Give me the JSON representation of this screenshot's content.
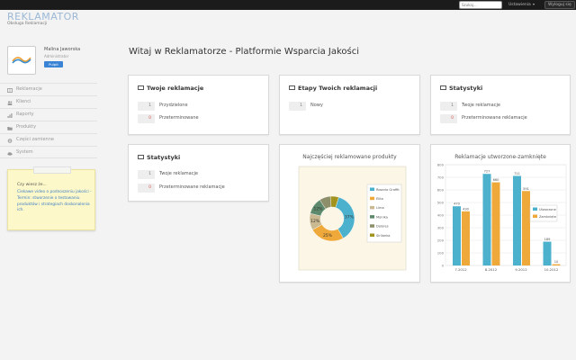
{
  "topbar": {
    "search_placeholder": "Szukaj...",
    "settings_label": "Ustawienia",
    "logout_label": "Wyloguj się"
  },
  "logo": {
    "title": "REKLAMATOR",
    "subtitle": "Obsługa Reklamacji"
  },
  "user": {
    "name": "Malina Jaworska",
    "role": "Administrator",
    "badge": "Pulpit"
  },
  "sidebar": {
    "items": [
      {
        "label": "Reklamacje",
        "icon": "book-icon"
      },
      {
        "label": "Klienci",
        "icon": "users-icon"
      },
      {
        "label": "Raporty",
        "icon": "bar-chart-icon"
      },
      {
        "label": "Produkty",
        "icon": "folder-icon"
      },
      {
        "label": "Części zamienne",
        "icon": "gear-icon"
      },
      {
        "label": "System",
        "icon": "cloud-icon"
      }
    ]
  },
  "note": {
    "title": "Czy wiesz że...",
    "link": "Ciekawe video o podnoszeniu jakości - Termin: stworzenie o testowaniu produktów i strategiach doskonalenia ich."
  },
  "page_title": "Witaj w Reklamatorze - Platformie Wsparcia Jakości",
  "panels": {
    "twoje": {
      "title": "Twoje reklamacje",
      "rows": [
        {
          "count": "1",
          "label": "Przydzielone",
          "color": "gray"
        },
        {
          "count": "0",
          "label": "Przeterminowane",
          "color": "red"
        }
      ]
    },
    "etapy": {
      "title": "Etapy Twoich reklamacji",
      "rows": [
        {
          "count": "1",
          "label": "Nowy",
          "color": "gray"
        }
      ]
    },
    "stat1": {
      "title": "Statystyki",
      "rows": [
        {
          "count": "1",
          "label": "Twoje reklamacje",
          "color": "gray"
        },
        {
          "count": "0",
          "label": "Przeterminowane reklamacje",
          "color": "red"
        }
      ]
    },
    "stat2": {
      "title": "Statystyki",
      "rows": [
        {
          "count": "1",
          "label": "Twoje reklamacje",
          "color": "gray"
        },
        {
          "count": "0",
          "label": "Przeterminowane reklamacje",
          "color": "red"
        }
      ]
    }
  },
  "chart_data": [
    {
      "type": "pie",
      "title": "Najczęściej reklamowane produkty",
      "donut": true,
      "categories": [
        "Rosario Graffit",
        "Elita",
        "Lima",
        "Monika",
        "Dolores",
        "Sirilanka"
      ],
      "values": [
        37,
        25,
        12,
        12,
        8,
        6
      ],
      "slice_labels": [
        "37%",
        "25%",
        "12%",
        "12%",
        "",
        ""
      ],
      "colors": [
        "#4cb1cd",
        "#efa93a",
        "#c9b890",
        "#5d8a6c",
        "#8c8f6a",
        "#a2921e"
      ],
      "legend": "right"
    },
    {
      "type": "bar",
      "title": "Reklamacje utworzone-zamknięte",
      "categories": [
        "7.2012",
        "8.2012",
        "9.2012",
        "10.2012"
      ],
      "series": [
        {
          "name": "Utworzone",
          "values": [
            470,
            727,
            711,
            189
          ],
          "color": "#4cb1cd"
        },
        {
          "name": "Zamknięte",
          "values": [
            430,
            660,
            591,
            10
          ],
          "color": "#efa93a"
        }
      ],
      "ylim": [
        0,
        800
      ],
      "yticks": [
        "0",
        "100",
        "200",
        "300",
        "400",
        "500",
        "600",
        "700",
        "800"
      ],
      "grid": true,
      "legend": "right"
    }
  ]
}
